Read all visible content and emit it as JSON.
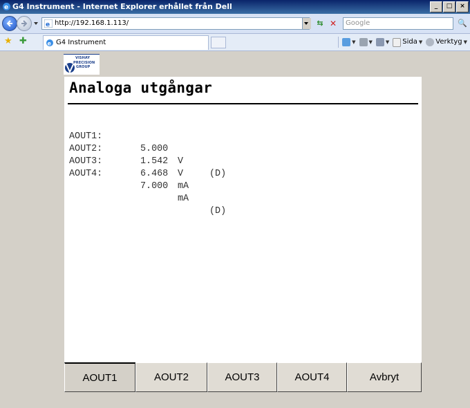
{
  "window": {
    "title": "G4 Instrument - Internet Explorer erhållet från Dell",
    "controls": [
      "_",
      "□",
      "×"
    ]
  },
  "addressbar": {
    "url": "http://192.168.1.113/",
    "search_placeholder": "Google"
  },
  "tabs": [
    {
      "label": "G4 Instrument"
    }
  ],
  "commandbar": {
    "items": [
      {
        "icon": "home-icon",
        "label": ""
      },
      {
        "icon": "feeds-icon",
        "label": ""
      },
      {
        "icon": "print-icon",
        "label": ""
      },
      {
        "icon": "page-icon",
        "label": "Sida"
      },
      {
        "icon": "tools-icon",
        "label": "Verktyg"
      }
    ]
  },
  "page": {
    "logo": {
      "line1": "VISHAY",
      "line2": "PRECISION",
      "line3": "GROUP"
    },
    "heading": "Analoga utgångar",
    "outputs": [
      {
        "label": "AOUT1:",
        "value": "5.000",
        "unit": "V",
        "flag": "(D)"
      },
      {
        "label": "AOUT2:",
        "value": "1.542",
        "unit": "V",
        "flag": ""
      },
      {
        "label": "AOUT3:",
        "value": "6.468",
        "unit": "mA",
        "flag": ""
      },
      {
        "label": "AOUT4:",
        "value": "7.000",
        "unit": "mA",
        "flag": "(D)"
      }
    ],
    "buttons": [
      {
        "label": "AOUT1",
        "active": true
      },
      {
        "label": "AOUT2",
        "active": false
      },
      {
        "label": "AOUT3",
        "active": false
      },
      {
        "label": "AOUT4",
        "active": false
      },
      {
        "label": "Avbryt",
        "active": false
      }
    ]
  }
}
